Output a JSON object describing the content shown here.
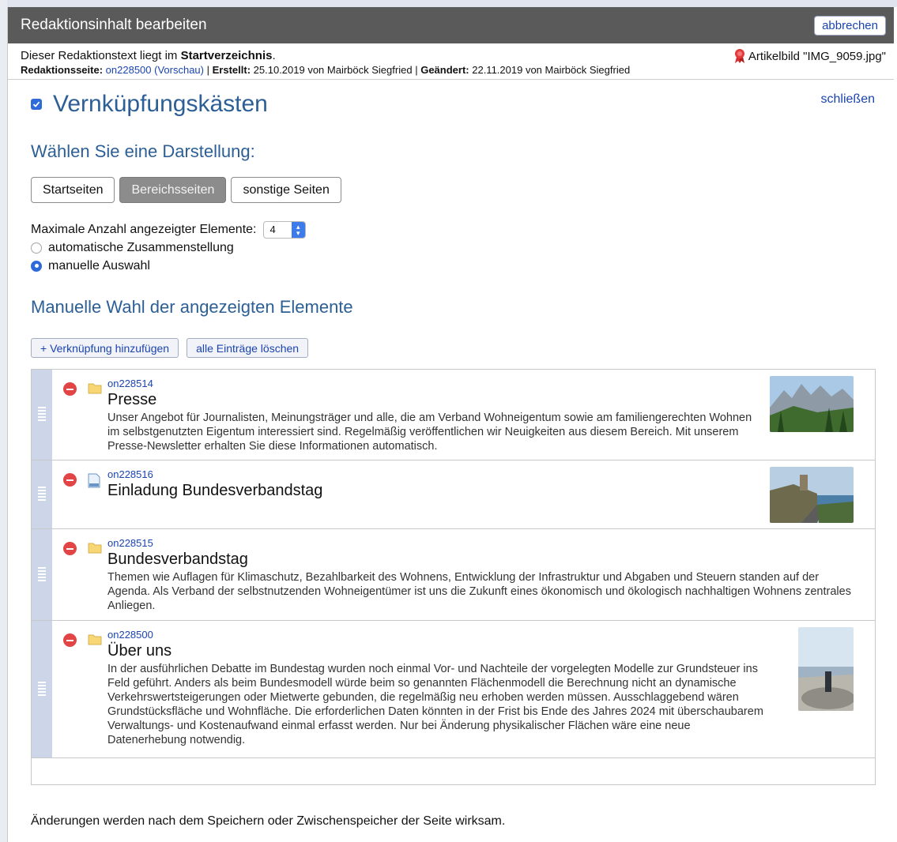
{
  "dialog": {
    "title": "Redaktionsinhalt bearbeiten",
    "cancel_label": "abbrechen"
  },
  "meta": {
    "line1_prefix": "Dieser Redaktionstext liegt im",
    "line1_location": "Startverzeichnis",
    "line1_suffix": ".",
    "image_info": "Artikelbild \"IMG_9059.jpg\"",
    "page_label": "Redaktionsseite:",
    "page_link": "on228500 (Vorschau)",
    "created_label": "Erstellt:",
    "created_value": "25.10.2019 von Mairböck Siegfried",
    "changed_label": "Geändert:",
    "changed_value": "22.11.2019 von Mairböck Siegfried",
    "separator": "|"
  },
  "section": {
    "title": "Vernküpfungskästen",
    "close_label": "schließen",
    "display_heading": "Wählen Sie eine Darstellung:",
    "display_options": [
      "Startseiten",
      "Bereichsseiten",
      "sonstige Seiten"
    ],
    "display_selected": "Bereichsseiten",
    "max_label": "Maximale Anzahl angezeigter Elemente:",
    "max_value": "4",
    "radio_auto": "automatische Zusammenstellung",
    "radio_manual": "manuelle Auswahl",
    "radio_selected": "manuelle Auswahl",
    "manual_heading": "Manuelle Wahl der angezeigten Elemente",
    "add_label": "+ Verknüpfung hinzufügen",
    "clear_label": "alle Einträge löschen"
  },
  "items": [
    {
      "code": "on228514",
      "title": "Presse",
      "type_icon": "folder-icon",
      "description": "Unser Angebot für Journalisten, Meinungsträger und alle, die am Verband Wohneigentum sowie am familiengerechten Wohnen im selbstgenutzten Eigentum interessiert sind. Regelmäßig veröffentlichen wir Neuigkeiten aus diesem Bereich. Mit unserem Presse-Newsletter erhalten Sie diese Informationen automatisch."
    },
    {
      "code": "on228516",
      "title": "Einladung Bundesverbandstag",
      "type_icon": "document-icon",
      "description": ""
    },
    {
      "code": "on228515",
      "title": "Bundesverbandstag",
      "type_icon": "folder-icon",
      "description": "Themen wie Auflagen für Klimaschutz, Bezahlbarkeit des Wohnens, Entwicklung der Infrastruktur und Abgaben und Steuern standen auf der Agenda. Als Verband der selbstnutzenden Wohneigentümer ist uns die Zukunft eines ökonomisch und ökologisch nachhaltigen Wohnens zentrales Anliegen."
    },
    {
      "code": "on228500",
      "title": "Über uns",
      "type_icon": "folder-icon",
      "description": "In der ausführlichen Debatte im Bundestag wurden noch einmal Vor- und Nachteile der vorgelegten Modelle zur Grundsteuer ins Feld geführt. Anders als beim Bundesmodell würde beim so genannten Flächenmodell die Berechnung nicht an dynamische Verkehrswertsteigerungen oder Mietwerte gebunden, die regelmäßig neu erhoben werden müssen. Ausschlaggebend wären Grundstücksfläche und Wohnfläche. Die erforderlichen Daten könnten in der Frist bis Ende des Jahres 2024 mit überschaubarem Verwaltungs- und Kostenaufwand einmal erfasst werden. Nur bei Änderung physikalischer Flächen wäre eine neue Datenerhebung notwendig."
    }
  ],
  "footer": {
    "note": "Änderungen werden nach dem Speichern oder Zwischenspeicher der Seite wirksam."
  },
  "colors": {
    "titlebar": "#5a5a5a",
    "heading": "#2c5f95",
    "link": "#1a44b0",
    "accent": "#2f6bd8",
    "delete": "#e24545",
    "handle": "#cdd6e8"
  }
}
